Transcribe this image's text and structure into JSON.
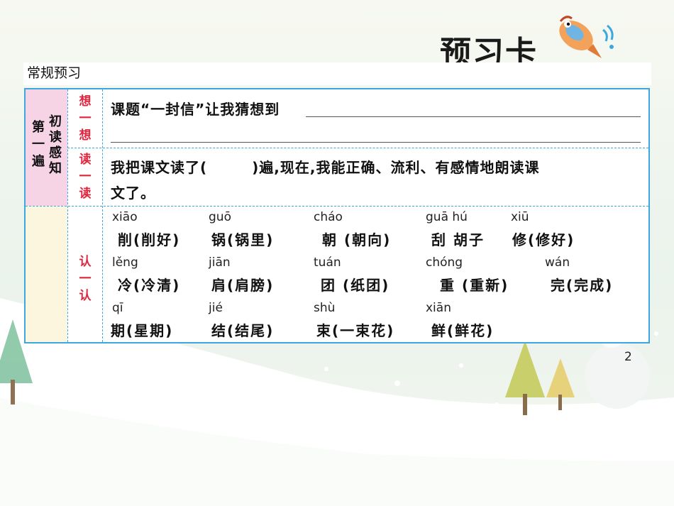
{
  "header": {
    "title": "预习卡"
  },
  "section": {
    "label": "常规预习"
  },
  "left_column": {
    "col_a": [
      "第",
      "一",
      "遍"
    ],
    "col_b": [
      "初",
      "读",
      "感",
      "知"
    ]
  },
  "rows": {
    "think": {
      "tag": [
        "想",
        "一",
        "想"
      ],
      "text": "课题“一封信”让我猜想到"
    },
    "read": {
      "tag": [
        "读",
        "一",
        "读"
      ],
      "line1": "我把课文读了(　　　)遍,现在,我能正确、流利、有感情地朗读课",
      "line2": "文了。"
    },
    "recognize": {
      "tag": [
        "认",
        "一",
        "认"
      ],
      "words": [
        [
          {
            "py": "xiāo",
            "ch": "削(削好)"
          },
          {
            "py": "guō",
            "ch": "锅(锅里)"
          },
          {
            "py": "cháo",
            "ch": "朝 (朝向)"
          },
          {
            "py": "guā hú",
            "ch": "刮 胡子"
          },
          {
            "py": "xiū",
            "ch": "修(修好)"
          }
        ],
        [
          {
            "py": "lěng",
            "ch": "冷(冷清)"
          },
          {
            "py": "jiān",
            "ch": "肩(肩膀)"
          },
          {
            "py": "tuán",
            "ch": "团 (纸团)"
          },
          {
            "py": "chóng",
            "ch": "重 (重新)"
          },
          {
            "py": "wán",
            "ch": "完(完成)"
          }
        ],
        [
          {
            "py": "qī",
            "ch": "期(星期)"
          },
          {
            "py": "jié",
            "ch": "结(结尾)"
          },
          {
            "py": "shù",
            "ch": "束(一束花)"
          },
          {
            "py": "xiān",
            "ch": "鲜(鲜花)"
          }
        ]
      ]
    }
  },
  "page_number": "2",
  "colors": {
    "border": "#3ba8df",
    "pink": "#f6d3e5",
    "beige": "#fbf6dd",
    "tag_red": "#e0243e"
  }
}
